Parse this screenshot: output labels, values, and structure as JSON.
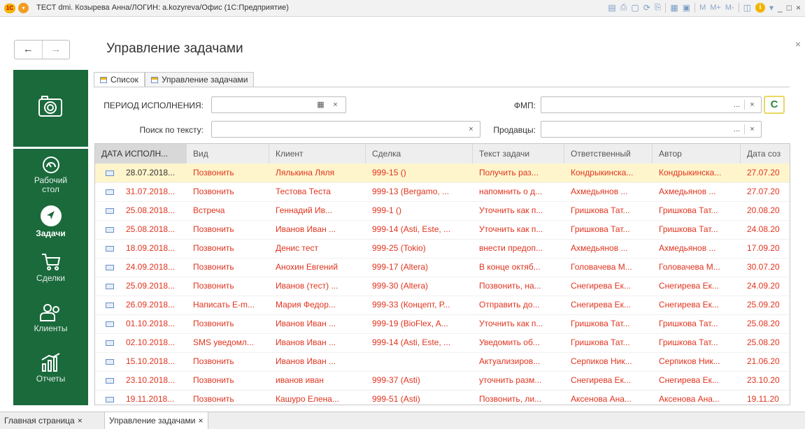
{
  "window": {
    "logo": "1С",
    "title": "ТЕСТ dmi. Козырева Анна/ЛОГИН: a.kozyreva/Офис (1С:Предприятие)",
    "toolbar_icons": [
      "save-icon",
      "print-icon",
      "preview-icon",
      "refresh-icon",
      "print2-icon",
      "calc-icon",
      "calendar-icon"
    ],
    "m_labels": [
      "M",
      "M+",
      "M-"
    ],
    "win_controls": [
      "_",
      "□",
      "×"
    ]
  },
  "nav": {
    "back": "←",
    "forward": "→"
  },
  "page": {
    "title": "Управление задачами",
    "close": "×"
  },
  "sidebar": {
    "items": [
      {
        "label": "Рабочий стол",
        "icon": "speedometer-icon"
      },
      {
        "label": "Задачи",
        "icon": "arrow-circle-icon",
        "active": true
      },
      {
        "label": "Сделки",
        "icon": "cart-icon"
      },
      {
        "label": "Клиенты",
        "icon": "people-icon"
      },
      {
        "label": "Отчеты",
        "icon": "chart-icon"
      }
    ]
  },
  "tabs": [
    {
      "label": "Список",
      "active": true
    },
    {
      "label": "Управление задачами",
      "active": false
    }
  ],
  "filters": {
    "period_label": "ПЕРИОД ИСПОЛНЕНИЯ:",
    "period_value": "",
    "search_label": "Поиск по тексту:",
    "search_value": "",
    "fmp_label": "ФМП:",
    "fmp_value": "",
    "sellers_label": "Продавцы:",
    "sellers_value": "",
    "ellipsis": "...",
    "clear": "×",
    "calendar": "▦",
    "refresh": "C"
  },
  "grid": {
    "columns": [
      "ДАТА ИСПОЛН...",
      "Вид",
      "Клиент",
      "Сделка",
      "Текст задачи",
      "Ответственный",
      "Автор",
      "Дата соз"
    ],
    "rows": [
      [
        "28.07.2018...",
        "Позвонить",
        "Лялькина Ляля",
        "999-15 ()",
        "Получить раз...",
        "Кондрыкинска...",
        "Кондрыкинска...",
        "27.07.20"
      ],
      [
        "31.07.2018...",
        "Позвонить",
        "Тестова Теста",
        "999-13 (Bergamo, ...",
        "напомнить о д...",
        "Ахмедьянов ...",
        "Ахмедьянов ...",
        "27.07.20"
      ],
      [
        "25.08.2018...",
        "Встреча",
        "Геннадий Ив...",
        "999-1 ()",
        "Уточнить как п...",
        "Гришкова Тат...",
        "Гришкова Тат...",
        "20.08.20"
      ],
      [
        "25.08.2018...",
        "Позвонить",
        "Иванов Иван ...",
        "999-14 (Asti, Este, ...",
        "Уточнить как п...",
        "Гришкова Тат...",
        "Гришкова Тат...",
        "24.08.20"
      ],
      [
        "18.09.2018...",
        "Позвонить",
        "Денис тест",
        "999-25 (Tokio)",
        "внести предоп...",
        "Ахмедьянов ...",
        "Ахмедьянов ...",
        "17.09.20"
      ],
      [
        "24.09.2018...",
        "Позвонить",
        "Анохин Евгений",
        "999-17 (Altera)",
        "В конце октяб...",
        "Головачева М...",
        "Головачева М...",
        "30.07.20"
      ],
      [
        "25.09.2018...",
        "Позвонить",
        "Иванов (тест) ...",
        "999-30 (Altera)",
        "Позвонить, на...",
        "Снегирева Ек...",
        "Снегирева Ек...",
        "24.09.20"
      ],
      [
        "26.09.2018...",
        "Написать E-m...",
        "Мария Федор...",
        "999-33 (Концепт, Р...",
        "Отправить до...",
        "Снегирева Ек...",
        "Снегирева Ек...",
        "25.09.20"
      ],
      [
        "01.10.2018...",
        "Позвонить",
        "Иванов Иван ...",
        "999-19 (BioFlex, A...",
        "Уточнить как п...",
        "Гришкова Тат...",
        "Гришкова Тат...",
        "25.08.20"
      ],
      [
        "02.10.2018...",
        "SMS уведомл...",
        "Иванов Иван ...",
        "999-14 (Asti, Este, ...",
        "Уведомить об...",
        "Гришкова Тат...",
        "Гришкова Тат...",
        "25.08.20"
      ],
      [
        "15.10.2018...",
        "Позвонить",
        "Иванов Иван ...",
        "",
        "Актуализиров...",
        "Серпиков Ник...",
        "Серпиков Ник...",
        "21.06.20"
      ],
      [
        "23.10.2018...",
        "Позвонить",
        "иванов иван",
        "999-37 (Asti)",
        "уточнить разм...",
        "Снегирева Ек...",
        "Снегирева Ек...",
        "23.10.20"
      ],
      [
        "19.11.2018...",
        "Позвонить",
        "Кашуро Елена...",
        "999-51 (Asti)",
        "Позвонить, ли...",
        "Аксенова Ана...",
        "Аксенова Ана...",
        "19.11.20"
      ]
    ]
  },
  "bottom_tabs": [
    {
      "label": "Главная страница",
      "close": "×",
      "active": false
    },
    {
      "label": "Управление задачами",
      "close": "×",
      "active": true
    }
  ],
  "colors": {
    "sidebar": "#1a6a3c",
    "row_text": "#e0341f",
    "selected_row": "#fff5cc"
  }
}
